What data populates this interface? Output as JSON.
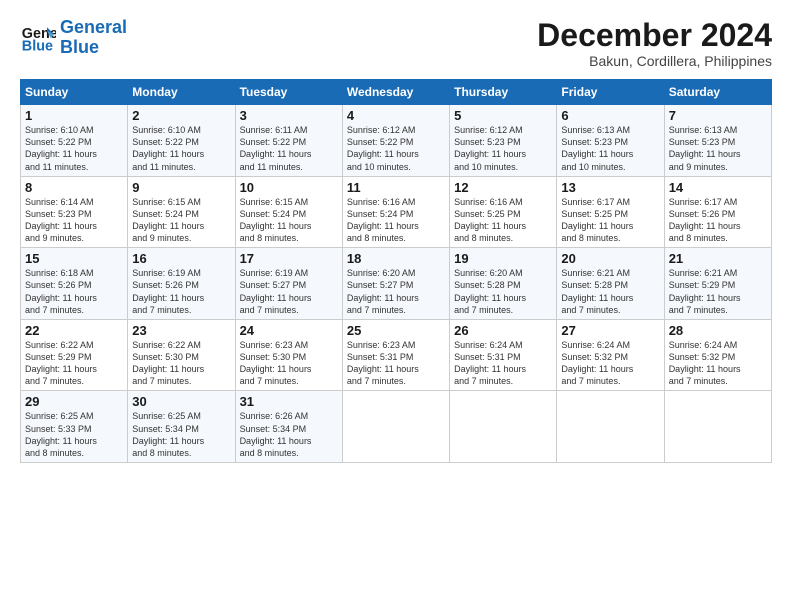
{
  "logo": {
    "line1": "General",
    "line2": "Blue"
  },
  "title": "December 2024",
  "subtitle": "Bakun, Cordillera, Philippines",
  "days_of_week": [
    "Sunday",
    "Monday",
    "Tuesday",
    "Wednesday",
    "Thursday",
    "Friday",
    "Saturday"
  ],
  "weeks": [
    [
      {
        "num": "1",
        "rise": "6:10 AM",
        "set": "5:22 PM",
        "daylight": "11 hours and 11 minutes."
      },
      {
        "num": "2",
        "rise": "6:10 AM",
        "set": "5:22 PM",
        "daylight": "11 hours and 11 minutes."
      },
      {
        "num": "3",
        "rise": "6:11 AM",
        "set": "5:22 PM",
        "daylight": "11 hours and 11 minutes."
      },
      {
        "num": "4",
        "rise": "6:12 AM",
        "set": "5:22 PM",
        "daylight": "11 hours and 10 minutes."
      },
      {
        "num": "5",
        "rise": "6:12 AM",
        "set": "5:23 PM",
        "daylight": "11 hours and 10 minutes."
      },
      {
        "num": "6",
        "rise": "6:13 AM",
        "set": "5:23 PM",
        "daylight": "11 hours and 10 minutes."
      },
      {
        "num": "7",
        "rise": "6:13 AM",
        "set": "5:23 PM",
        "daylight": "11 hours and 9 minutes."
      }
    ],
    [
      {
        "num": "8",
        "rise": "6:14 AM",
        "set": "5:23 PM",
        "daylight": "11 hours and 9 minutes."
      },
      {
        "num": "9",
        "rise": "6:15 AM",
        "set": "5:24 PM",
        "daylight": "11 hours and 9 minutes."
      },
      {
        "num": "10",
        "rise": "6:15 AM",
        "set": "5:24 PM",
        "daylight": "11 hours and 8 minutes."
      },
      {
        "num": "11",
        "rise": "6:16 AM",
        "set": "5:24 PM",
        "daylight": "11 hours and 8 minutes."
      },
      {
        "num": "12",
        "rise": "6:16 AM",
        "set": "5:25 PM",
        "daylight": "11 hours and 8 minutes."
      },
      {
        "num": "13",
        "rise": "6:17 AM",
        "set": "5:25 PM",
        "daylight": "11 hours and 8 minutes."
      },
      {
        "num": "14",
        "rise": "6:17 AM",
        "set": "5:26 PM",
        "daylight": "11 hours and 8 minutes."
      }
    ],
    [
      {
        "num": "15",
        "rise": "6:18 AM",
        "set": "5:26 PM",
        "daylight": "11 hours and 7 minutes."
      },
      {
        "num": "16",
        "rise": "6:19 AM",
        "set": "5:26 PM",
        "daylight": "11 hours and 7 minutes."
      },
      {
        "num": "17",
        "rise": "6:19 AM",
        "set": "5:27 PM",
        "daylight": "11 hours and 7 minutes."
      },
      {
        "num": "18",
        "rise": "6:20 AM",
        "set": "5:27 PM",
        "daylight": "11 hours and 7 minutes."
      },
      {
        "num": "19",
        "rise": "6:20 AM",
        "set": "5:28 PM",
        "daylight": "11 hours and 7 minutes."
      },
      {
        "num": "20",
        "rise": "6:21 AM",
        "set": "5:28 PM",
        "daylight": "11 hours and 7 minutes."
      },
      {
        "num": "21",
        "rise": "6:21 AM",
        "set": "5:29 PM",
        "daylight": "11 hours and 7 minutes."
      }
    ],
    [
      {
        "num": "22",
        "rise": "6:22 AM",
        "set": "5:29 PM",
        "daylight": "11 hours and 7 minutes."
      },
      {
        "num": "23",
        "rise": "6:22 AM",
        "set": "5:30 PM",
        "daylight": "11 hours and 7 minutes."
      },
      {
        "num": "24",
        "rise": "6:23 AM",
        "set": "5:30 PM",
        "daylight": "11 hours and 7 minutes."
      },
      {
        "num": "25",
        "rise": "6:23 AM",
        "set": "5:31 PM",
        "daylight": "11 hours and 7 minutes."
      },
      {
        "num": "26",
        "rise": "6:24 AM",
        "set": "5:31 PM",
        "daylight": "11 hours and 7 minutes."
      },
      {
        "num": "27",
        "rise": "6:24 AM",
        "set": "5:32 PM",
        "daylight": "11 hours and 7 minutes."
      },
      {
        "num": "28",
        "rise": "6:24 AM",
        "set": "5:32 PM",
        "daylight": "11 hours and 7 minutes."
      }
    ],
    [
      {
        "num": "29",
        "rise": "6:25 AM",
        "set": "5:33 PM",
        "daylight": "11 hours and 8 minutes."
      },
      {
        "num": "30",
        "rise": "6:25 AM",
        "set": "5:34 PM",
        "daylight": "11 hours and 8 minutes."
      },
      {
        "num": "31",
        "rise": "6:26 AM",
        "set": "5:34 PM",
        "daylight": "11 hours and 8 minutes."
      },
      null,
      null,
      null,
      null
    ]
  ]
}
